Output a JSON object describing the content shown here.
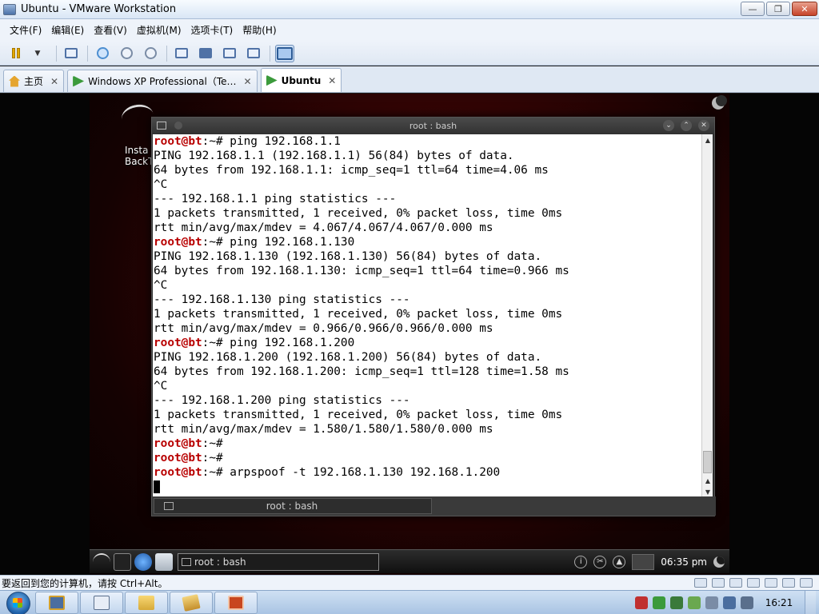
{
  "window": {
    "title": "Ubuntu - VMware Workstation",
    "minimize": "—",
    "maximize": "❐",
    "close": "✕"
  },
  "menu": [
    {
      "label": "文件(F)"
    },
    {
      "label": "编辑(E)"
    },
    {
      "label": "查看(V)"
    },
    {
      "label": "虚拟机(M)"
    },
    {
      "label": "选项卡(T)"
    },
    {
      "label": "帮助(H)"
    }
  ],
  "tabs": [
    {
      "label": "主页",
      "icon": "home-icon"
    },
    {
      "label": "Windows XP Professional（Te…",
      "icon": "vm-running-icon"
    },
    {
      "label": "Ubuntu",
      "icon": "vm-running-icon",
      "active": true
    }
  ],
  "tab_close": "✕",
  "desktop": {
    "icon_label_1": "Insta",
    "icon_label_2": "BackTr"
  },
  "terminal": {
    "title": "root : bash",
    "prompt_user": "root@bt",
    "lines": [
      {
        "prompt": true,
        "rest": ":~# ping 192.168.1.1"
      },
      {
        "text": "PING 192.168.1.1 (192.168.1.1) 56(84) bytes of data."
      },
      {
        "text": "64 bytes from 192.168.1.1: icmp_seq=1 ttl=64 time=4.06 ms"
      },
      {
        "text": "^C"
      },
      {
        "text": "--- 192.168.1.1 ping statistics ---"
      },
      {
        "text": "1 packets transmitted, 1 received, 0% packet loss, time 0ms"
      },
      {
        "text": "rtt min/avg/max/mdev = 4.067/4.067/4.067/0.000 ms"
      },
      {
        "prompt": true,
        "rest": ":~# ping 192.168.1.130"
      },
      {
        "text": "PING 192.168.1.130 (192.168.1.130) 56(84) bytes of data."
      },
      {
        "text": "64 bytes from 192.168.1.130: icmp_seq=1 ttl=64 time=0.966 ms"
      },
      {
        "text": "^C"
      },
      {
        "text": "--- 192.168.1.130 ping statistics ---"
      },
      {
        "text": "1 packets transmitted, 1 received, 0% packet loss, time 0ms"
      },
      {
        "text": "rtt min/avg/max/mdev = 0.966/0.966/0.966/0.000 ms"
      },
      {
        "prompt": true,
        "rest": ":~# ping 192.168.1.200"
      },
      {
        "text": "PING 192.168.1.200 (192.168.1.200) 56(84) bytes of data."
      },
      {
        "text": "64 bytes from 192.168.1.200: icmp_seq=1 ttl=128 time=1.58 ms"
      },
      {
        "text": "^C"
      },
      {
        "text": "--- 192.168.1.200 ping statistics ---"
      },
      {
        "text": "1 packets transmitted, 1 received, 0% packet loss, time 0ms"
      },
      {
        "text": "rtt min/avg/max/mdev = 1.580/1.580/1.580/0.000 ms"
      },
      {
        "prompt": true,
        "rest": ":~#"
      },
      {
        "prompt": true,
        "rest": ":~#"
      },
      {
        "prompt": true,
        "rest": ":~# arpspoof -t 192.168.1.130 192.168.1.200"
      }
    ],
    "tab_label": "root : bash"
  },
  "guest_taskbar": {
    "task_label": "root : bash",
    "clock": "06:35 pm"
  },
  "status_bar": {
    "message": "要返回到您的计算机，请按 Ctrl+Alt。"
  },
  "host_taskbar": {
    "clock": "16:21"
  },
  "colors": {
    "prompt_user": "#b80000",
    "desktop_red": "#7a0d0d",
    "host_accent": "#3c5f91"
  }
}
